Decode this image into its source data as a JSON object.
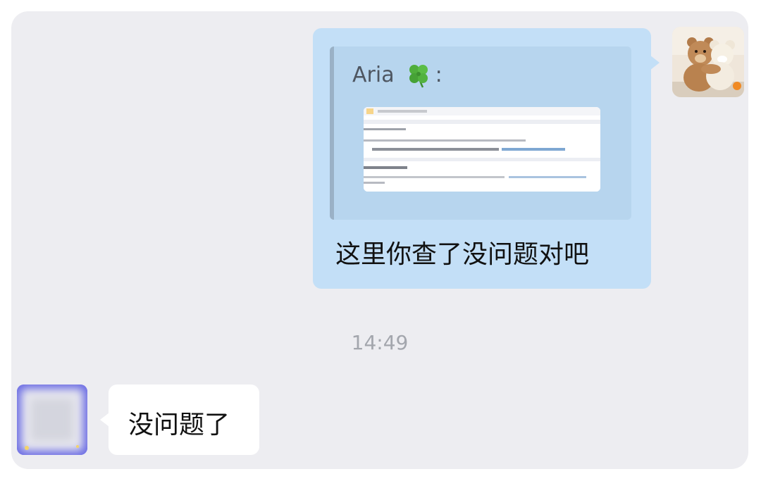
{
  "conversation": {
    "messages": [
      {
        "direction": "outgoing",
        "avatar": "teddy-bears-avatar",
        "quote": {
          "sender": "Aria",
          "sender_suffix": ":",
          "sender_emoji_icon": "four-leaf-clover-icon",
          "attachment_icon": "screenshot-thumbnail"
        },
        "text": "这里你查了没问题对吧"
      },
      {
        "direction": "incoming",
        "avatar": "blurred-avatar",
        "text": "没问题了"
      }
    ],
    "timestamp": "14:49"
  },
  "colors": {
    "panel_background": "#ededf1",
    "outgoing_bubble": "#c3dff7",
    "incoming_bubble": "#ffffff",
    "quote_background": "#b7d5ee",
    "timestamp_text": "#a3a6ad"
  }
}
